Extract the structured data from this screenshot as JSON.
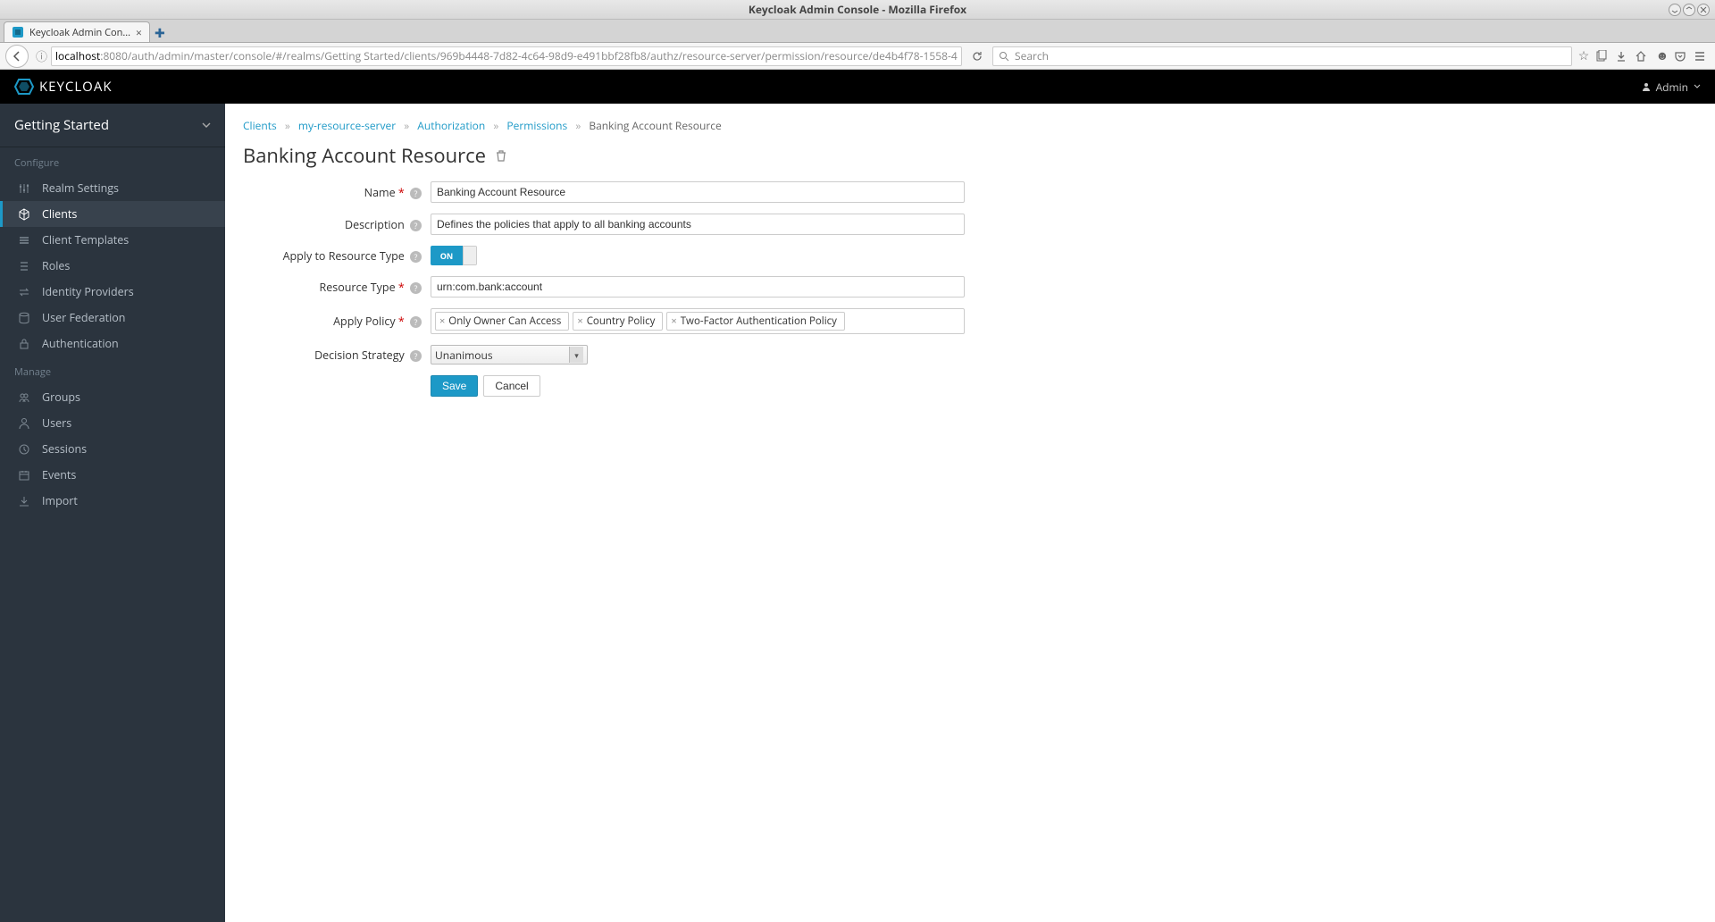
{
  "os": {
    "window_title": "Keycloak Admin Console - Mozilla Firefox"
  },
  "browser": {
    "tab_title": "Keycloak Admin Con...",
    "url_host": "localhost",
    "url_path": ":8080/auth/admin/master/console/#/realms/Getting Started/clients/969b4448-7d82-4c64-98d9-e491bbf28fb8/authz/resource-server/permission/resource/de4b4f78-1558-4",
    "search_placeholder": "Search"
  },
  "header": {
    "brand": "KEYCLOAK",
    "user_label": "Admin"
  },
  "sidebar": {
    "realm": "Getting Started",
    "sections": {
      "configure_label": "Configure",
      "manage_label": "Manage"
    },
    "configure": [
      {
        "label": "Realm Settings"
      },
      {
        "label": "Clients"
      },
      {
        "label": "Client Templates"
      },
      {
        "label": "Roles"
      },
      {
        "label": "Identity Providers"
      },
      {
        "label": "User Federation"
      },
      {
        "label": "Authentication"
      }
    ],
    "manage": [
      {
        "label": "Groups"
      },
      {
        "label": "Users"
      },
      {
        "label": "Sessions"
      },
      {
        "label": "Events"
      },
      {
        "label": "Import"
      }
    ]
  },
  "breadcrumb": {
    "items": [
      "Clients",
      "my-resource-server",
      "Authorization",
      "Permissions"
    ],
    "current": "Banking Account Resource"
  },
  "page": {
    "title": "Banking Account Resource"
  },
  "form": {
    "name": {
      "label": "Name",
      "value": "Banking Account Resource"
    },
    "description": {
      "label": "Description",
      "value": "Defines the policies that apply to all banking accounts"
    },
    "apply_type": {
      "label": "Apply to Resource Type",
      "value": "ON"
    },
    "resource_type": {
      "label": "Resource Type",
      "value": "urn:com.bank:account"
    },
    "apply_policy": {
      "label": "Apply Policy",
      "tags": [
        "Only Owner Can Access",
        "Country Policy",
        "Two-Factor Authentication Policy"
      ]
    },
    "decision": {
      "label": "Decision Strategy",
      "value": "Unanimous"
    },
    "buttons": {
      "save": "Save",
      "cancel": "Cancel"
    }
  }
}
